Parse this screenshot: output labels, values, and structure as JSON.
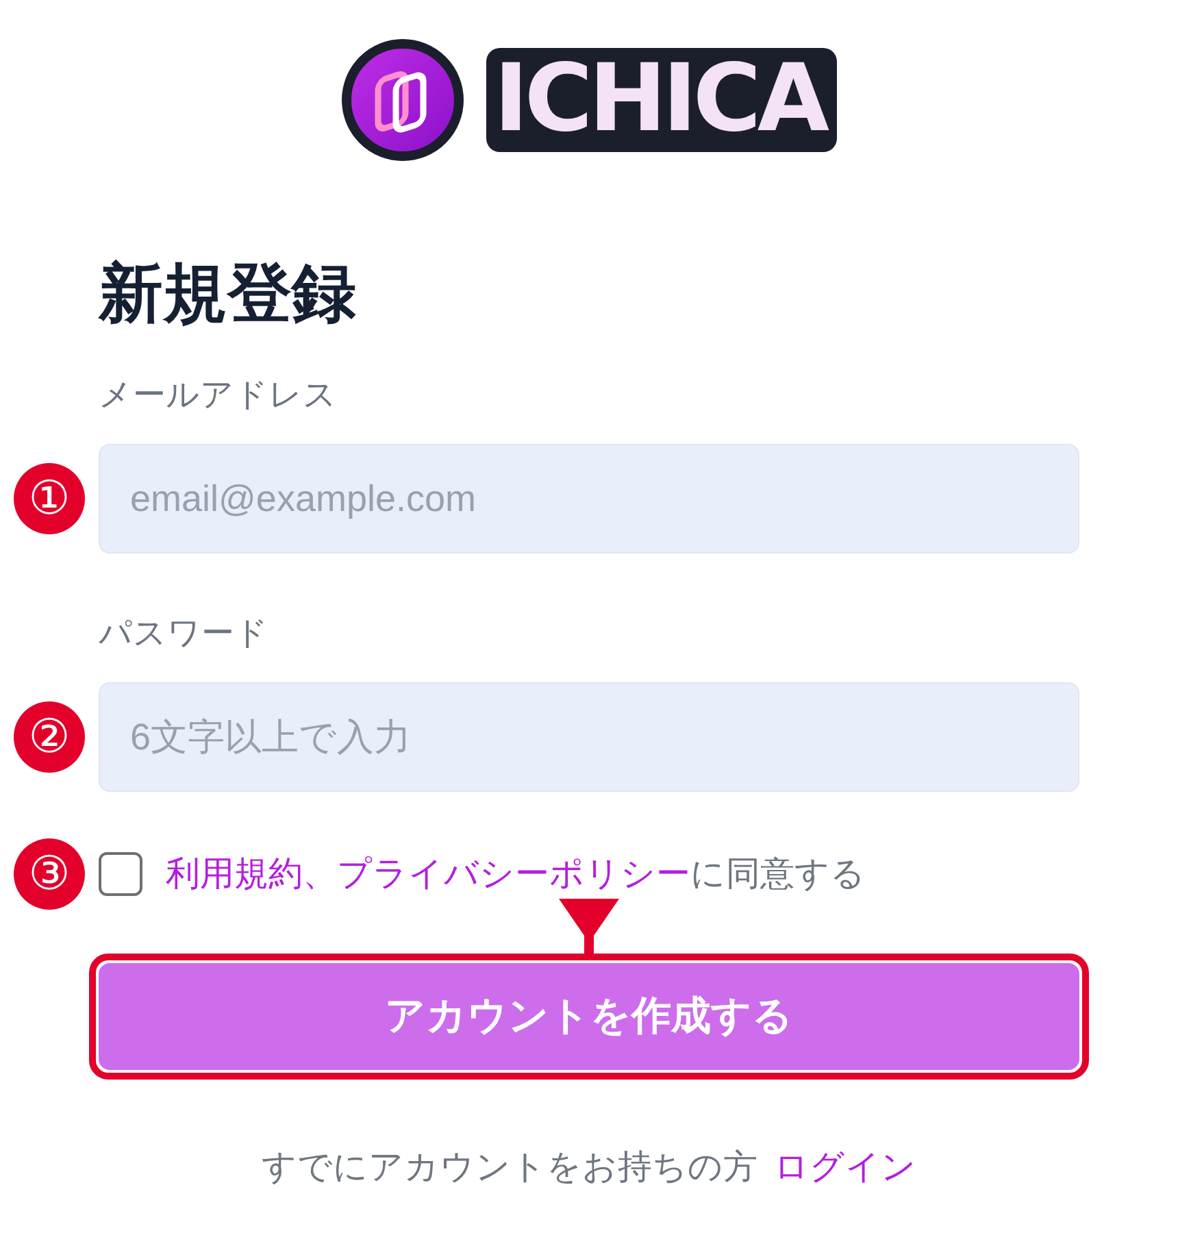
{
  "logo": {
    "wordmark": "ICHICA"
  },
  "heading": "新規登録",
  "fields": [
    {
      "label": "メールアドレス",
      "marker": "①",
      "placeholder": "email@example.com"
    },
    {
      "label": "パスワード",
      "marker": "②",
      "placeholder": "6文字以上で入力"
    }
  ],
  "agreement": {
    "marker": "③",
    "checked": false,
    "parts": [
      {
        "text": "利用規約",
        "kind": "link"
      },
      {
        "text": "、",
        "kind": "accent"
      },
      {
        "text": "プライバシーポリシー",
        "kind": "link"
      },
      {
        "text": "に同意する",
        "kind": "plain"
      }
    ]
  },
  "submit": {
    "label": "アカウントを作成する",
    "highlighted": true
  },
  "footer": {
    "text": "すでにアカウントをお持ちの方",
    "link": "ログイン"
  }
}
